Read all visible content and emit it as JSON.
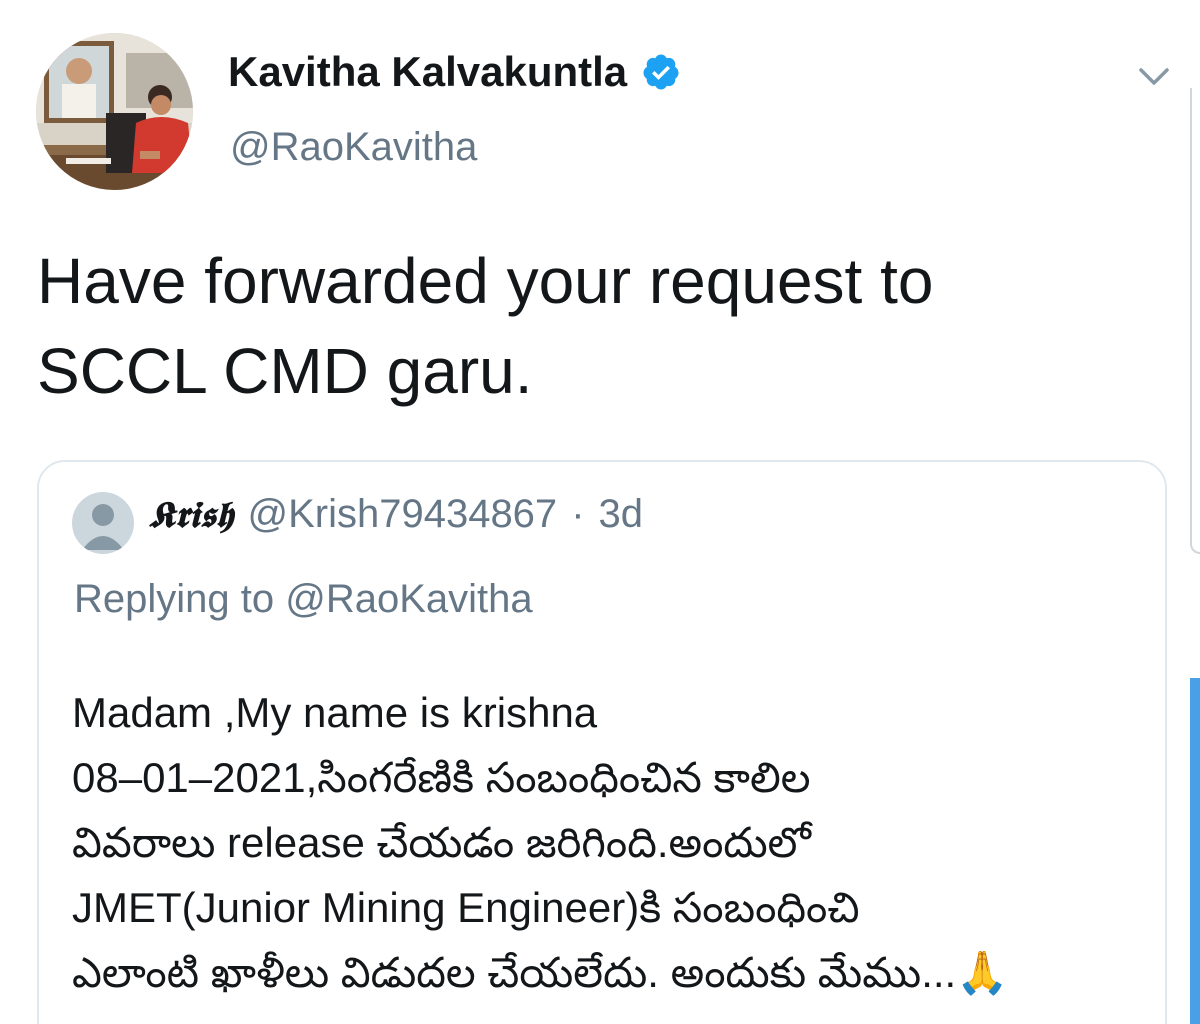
{
  "author": {
    "display_name": "Kavitha Kalvakuntla",
    "handle": "@RaoKavitha",
    "verified": true,
    "avatar_icon": "profile-photo"
  },
  "tweet": {
    "lines": [
      "Have forwarded your request to",
      "SCCL CMD garu."
    ]
  },
  "quoted_tweet": {
    "display_name": "𝕶𝖗𝖎𝖘𝖍",
    "handle": "@Krish79434867",
    "separator": "·",
    "time": "3d",
    "replying_prefix": "Replying to",
    "replying_handle": "@RaoKavitha",
    "avatar_icon": "default-avatar-icon",
    "lines": [
      "Madam ,My name is krishna",
      "08–01–2021,సింగరేణికి సంబంధించిన కాలిల",
      "వివరాలు release చేయడం జరిగింది.అందులో",
      "JMET(Junior Mining Engineer)కి సంబంధించి",
      "ఎలాంటి ఖాళీలు విడుదల చేయలేదు. అందుకు మేము...🙏"
    ]
  },
  "colors": {
    "text_primary": "#14171a",
    "text_secondary": "#657786",
    "verified_blue": "#1da1f2",
    "border": "#e1e8ed",
    "scrollbar": "#4aa0e6"
  }
}
